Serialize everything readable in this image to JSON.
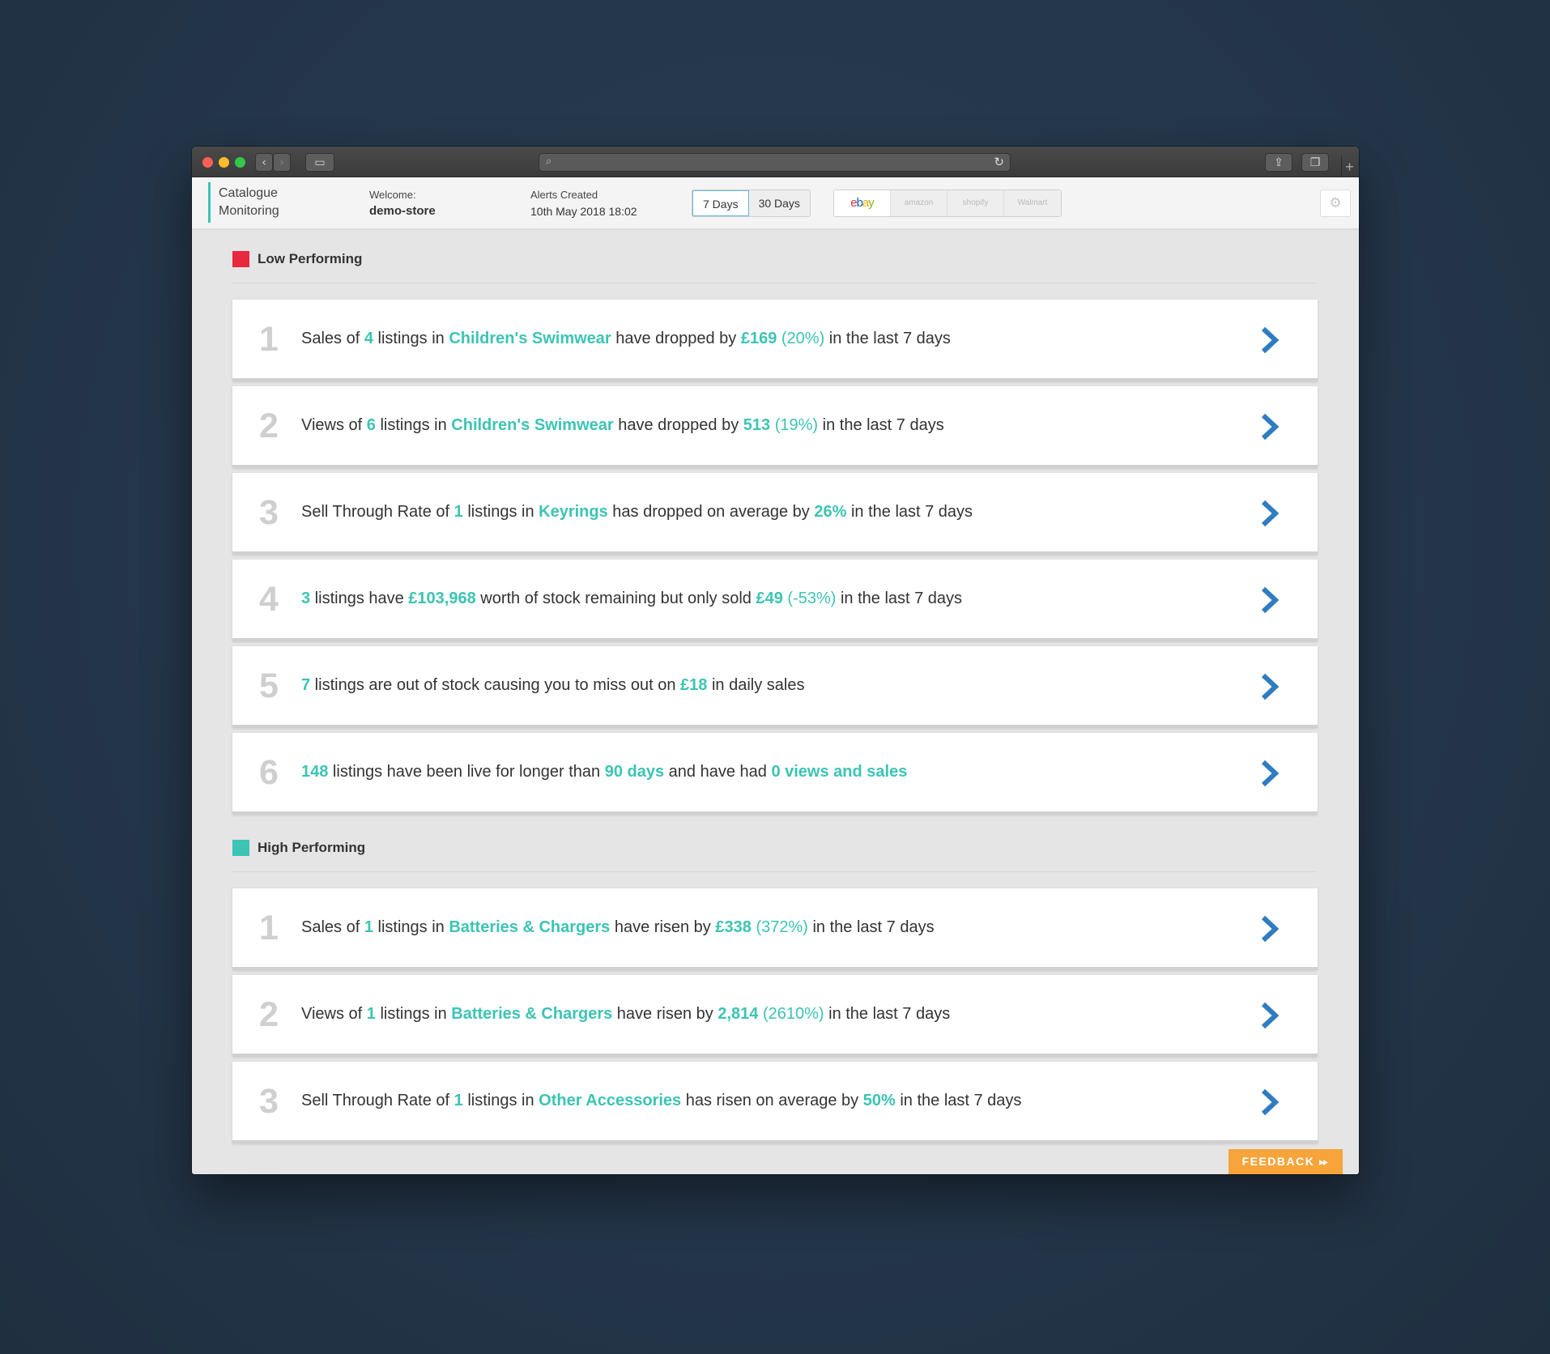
{
  "header": {
    "brand_line1": "Catalogue",
    "brand_line2": "Monitoring",
    "welcome_label": "Welcome:",
    "welcome_user": "demo-store",
    "alerts_label": "Alerts Created",
    "alerts_date": "10th May 2018 18:02",
    "period_options": [
      "7 Days",
      "30 Days"
    ],
    "selected_period": "7 Days",
    "marketplaces": [
      "ebay",
      "amazon",
      "shopify",
      "Walmart"
    ],
    "selected_marketplace": "ebay"
  },
  "low": {
    "title": "Low Performing",
    "color": "#e8283c",
    "alerts": [
      {
        "number": "1",
        "parts": [
          [
            "t",
            "Sales of "
          ],
          [
            "h",
            "4"
          ],
          [
            "t",
            " listings in "
          ],
          [
            "h",
            "Children's Swimwear"
          ],
          [
            "t",
            " have dropped by "
          ],
          [
            "h",
            "£169"
          ],
          [
            "t",
            " "
          ],
          [
            "p",
            "(20%)"
          ],
          [
            "t",
            " in the last 7 days"
          ]
        ]
      },
      {
        "number": "2",
        "parts": [
          [
            "t",
            "Views of "
          ],
          [
            "h",
            "6"
          ],
          [
            "t",
            " listings in "
          ],
          [
            "h",
            "Children's Swimwear"
          ],
          [
            "t",
            " have dropped by "
          ],
          [
            "h",
            "513"
          ],
          [
            "t",
            " "
          ],
          [
            "p",
            "(19%)"
          ],
          [
            "t",
            " in the last 7 days"
          ]
        ]
      },
      {
        "number": "3",
        "parts": [
          [
            "t",
            "Sell Through Rate of "
          ],
          [
            "h",
            "1"
          ],
          [
            "t",
            " listings in "
          ],
          [
            "h",
            "Keyrings"
          ],
          [
            "t",
            " has dropped on average by "
          ],
          [
            "h",
            "26%"
          ],
          [
            "t",
            " in the last 7 days"
          ]
        ]
      },
      {
        "number": "4",
        "parts": [
          [
            "h",
            "3"
          ],
          [
            "t",
            " listings have "
          ],
          [
            "h",
            "£103,968"
          ],
          [
            "t",
            " worth of stock remaining but only sold "
          ],
          [
            "h",
            "£49"
          ],
          [
            "t",
            " "
          ],
          [
            "p",
            "(-53%)"
          ],
          [
            "t",
            " in the last 7 days"
          ]
        ]
      },
      {
        "number": "5",
        "parts": [
          [
            "h",
            "7"
          ],
          [
            "t",
            " listings are out of stock causing you to miss out on "
          ],
          [
            "h",
            "£18"
          ],
          [
            "t",
            " in daily sales"
          ]
        ]
      },
      {
        "number": "6",
        "parts": [
          [
            "h",
            "148"
          ],
          [
            "t",
            " listings have been live for longer than "
          ],
          [
            "h",
            "90 days"
          ],
          [
            "t",
            " and have had "
          ],
          [
            "h",
            "0 views and sales"
          ]
        ]
      }
    ]
  },
  "high": {
    "title": "High Performing",
    "color": "#3cc4b4",
    "alerts": [
      {
        "number": "1",
        "parts": [
          [
            "t",
            "Sales of "
          ],
          [
            "h",
            "1"
          ],
          [
            "t",
            " listings in "
          ],
          [
            "h",
            "Batteries & Chargers"
          ],
          [
            "t",
            " have risen by "
          ],
          [
            "h",
            "£338"
          ],
          [
            "t",
            " "
          ],
          [
            "p",
            "(372%)"
          ],
          [
            "t",
            " in the last 7 days"
          ]
        ]
      },
      {
        "number": "2",
        "parts": [
          [
            "t",
            "Views of "
          ],
          [
            "h",
            "1"
          ],
          [
            "t",
            " listings in "
          ],
          [
            "h",
            "Batteries & Chargers"
          ],
          [
            "t",
            " have risen by "
          ],
          [
            "h",
            "2,814"
          ],
          [
            "t",
            " "
          ],
          [
            "p",
            "(2610%)"
          ],
          [
            "t",
            " in the last 7 days"
          ]
        ]
      },
      {
        "number": "3",
        "parts": [
          [
            "t",
            "Sell Through Rate of "
          ],
          [
            "h",
            "1"
          ],
          [
            "t",
            " listings in "
          ],
          [
            "h",
            "Other Accessories"
          ],
          [
            "t",
            " has risen on average by "
          ],
          [
            "h",
            "50%"
          ],
          [
            "t",
            " in the last 7 days"
          ]
        ]
      }
    ]
  },
  "feedback_label": "FEEDBACK",
  "colors": {
    "accent": "#3cc4b4",
    "chevron": "#2f7dc0",
    "feedback": "#f7a43b"
  }
}
